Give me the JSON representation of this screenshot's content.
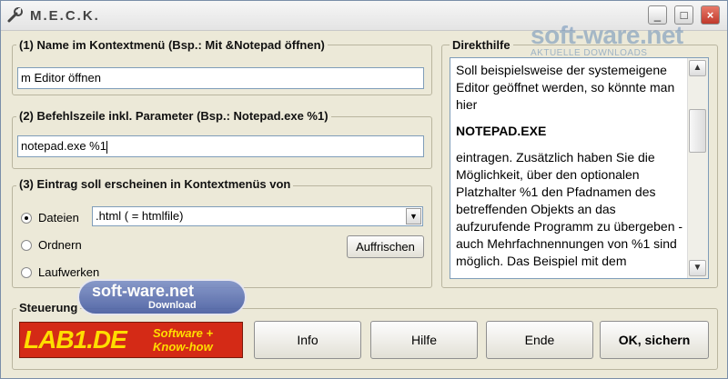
{
  "window": {
    "title": "M.E.C.K.",
    "minimize_icon": "minimize-icon",
    "maximize_icon": "maximize-icon",
    "close_icon": "close-icon"
  },
  "group1": {
    "title": "(1) Name im Kontextmenü (Bsp.: Mit &Notepad öffnen)",
    "value": "m Editor öffnen"
  },
  "group2": {
    "title": "(2) Befehlszeile inkl. Parameter (Bsp.: Notepad.exe %1)",
    "value": "notepad.exe %1"
  },
  "group3": {
    "title": "(3) Eintrag soll erscheinen in Kontextmenüs von",
    "options": [
      "Dateien",
      "Ordnern",
      "Laufwerken"
    ],
    "selected": "Dateien",
    "dropdown_value": ".html  ( = htmlfile)",
    "refresh_label": "Auffrischen"
  },
  "help": {
    "title": "Direkthilfe",
    "para1": "Soll beispielsweise der systemeigene Editor geöffnet werden, so könnte man hier",
    "para2": "NOTEPAD.EXE",
    "para3": "eintragen. Zusätzlich haben Sie die Möglichkeit, über den optionalen Platzhalter %1 den Pfadnamen des betreffenden Objekts an das aufzurufende Programm zu übergeben - auch Mehrfachnennungen von  %1 sind möglich. Das Beispiel mit dem"
  },
  "control": {
    "title": "Steuerung",
    "logo_text": "LAB1.DE",
    "logo_tag1": "Software +",
    "logo_tag2": "Know-how",
    "buttons": {
      "info": "Info",
      "hilfe": "Hilfe",
      "ende": "Ende",
      "ok": "OK, sichern"
    }
  },
  "watermarks": {
    "top_main": "soft-ware.net",
    "top_sub": "AKTUELLE DOWNLOADS",
    "badge_main": "soft-ware.net",
    "badge_sub": "Download"
  },
  "colors": {
    "window_bg": "#ece9d8",
    "logo_bg": "#d42a16",
    "logo_text": "#ffdd00",
    "close_red": "#c0392b"
  }
}
